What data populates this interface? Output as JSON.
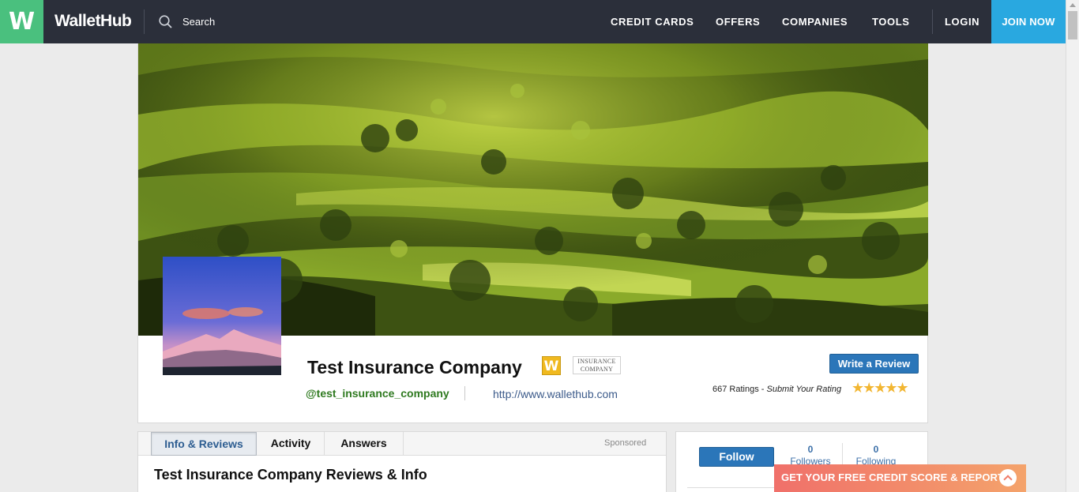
{
  "nav": {
    "logo_letter": "W",
    "logo_text": "WalletHub",
    "search_label": "Search",
    "links": [
      "CREDIT CARDS",
      "OFFERS",
      "COMPANIES",
      "TOOLS"
    ],
    "login": "LOGIN",
    "join": "JOIN NOW"
  },
  "profile": {
    "name": "Test Insurance Company",
    "w_badge": "W",
    "type_badge_line1": "INSURANCE",
    "type_badge_line2": "COMPANY",
    "handle": "@test_insurance_company",
    "url": "http://www.wallethub.com",
    "write_review": "Write a Review",
    "ratings_count": "667 Ratings - ",
    "submit_rating": "Submit Your Rating",
    "stars": "★★★★★"
  },
  "tabs": {
    "items": [
      "Info & Reviews",
      "Activity",
      "Answers"
    ],
    "active": "Info & Reviews",
    "sponsored": "Sponsored"
  },
  "main": {
    "section_title": "Test Insurance Company Reviews & Info"
  },
  "sidebar": {
    "follow": "Follow",
    "followers_count": "0",
    "followers_label": "Followers",
    "following_count": "0",
    "following_label": "Following"
  },
  "banner": {
    "credit_text": "GET YOUR FREE CREDIT SCORE & REPORT"
  },
  "colors": {
    "brand_green": "#4ac07e",
    "nav_bg": "#2b2f3a",
    "join_blue": "#29a8e0",
    "button_blue": "#2b76b9",
    "star": "#f2b632"
  }
}
